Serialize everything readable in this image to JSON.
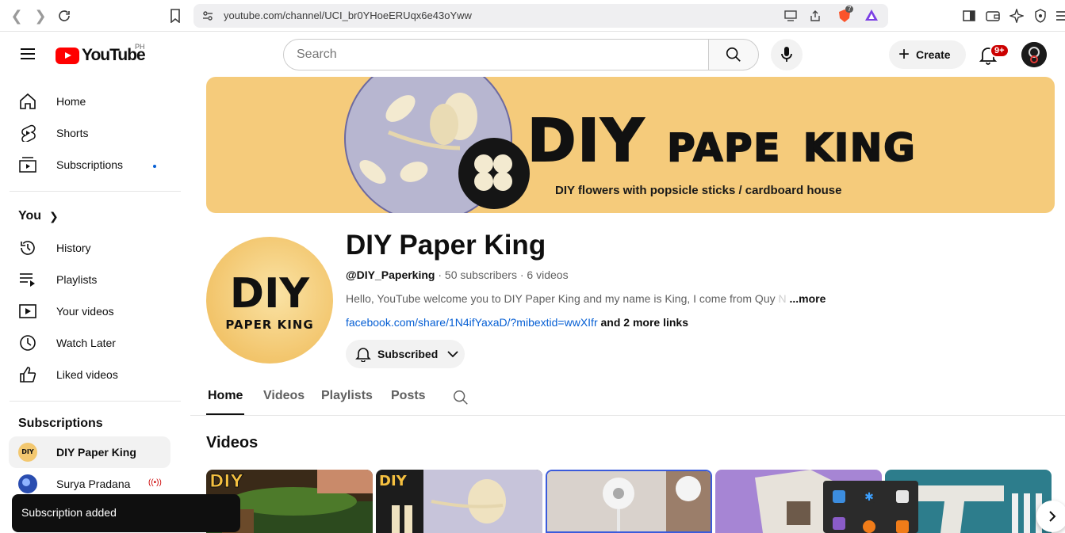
{
  "browser": {
    "url": "youtube.com/channel/UCI_br0YHoeERUqx6e43oYww",
    "brave_badge": "7"
  },
  "header": {
    "logo_text": "YouTube",
    "country_code": "PH",
    "search_placeholder": "Search",
    "create_label": "Create",
    "notifications_badge": "9+"
  },
  "sidebar": {
    "main": [
      {
        "label": "Home",
        "icon": "home-icon"
      },
      {
        "label": "Shorts",
        "icon": "shorts-icon"
      },
      {
        "label": "Subscriptions",
        "icon": "subscriptions-icon"
      }
    ],
    "you_heading": "You",
    "you_items": [
      {
        "label": "History",
        "icon": "history-icon"
      },
      {
        "label": "Playlists",
        "icon": "playlists-icon"
      },
      {
        "label": "Your videos",
        "icon": "your-videos-icon"
      },
      {
        "label": "Watch Later",
        "icon": "watch-later-icon"
      },
      {
        "label": "Liked videos",
        "icon": "liked-videos-icon"
      }
    ],
    "subs_heading": "Subscriptions",
    "subs": [
      {
        "label": "DIY Paper King"
      },
      {
        "label": "Surya Pradana"
      }
    ]
  },
  "banner": {
    "title_a": "DIY",
    "title_b": "PAPE",
    "title_c": "KING",
    "subtitle": "DIY flowers with popsicle sticks / cardboard house"
  },
  "channel": {
    "avatar_top": "DIY",
    "avatar_bottom": "PAPER KING",
    "name": "DIY Paper King",
    "handle": "@DIY_Paperking",
    "subscribers": "50 subscribers",
    "videos": "6 videos",
    "description": "Hello, YouTube welcome you to DIY Paper King and my name is King,  I come from Quy ",
    "description_fade": "N",
    "more": "...more",
    "link": "facebook.com/share/1N4ifYaxaD/?mibextid=wwXIfr",
    "more_links": "and 2 more links",
    "subscribed_label": "Subscribed"
  },
  "tabs": [
    "Home",
    "Videos",
    "Playlists",
    "Posts"
  ],
  "videos_heading": "Videos",
  "toast": "Subscription added",
  "colors": {
    "accent": "#ff0000",
    "banner_bg": "#f5cb7b",
    "link": "#065fd4"
  }
}
